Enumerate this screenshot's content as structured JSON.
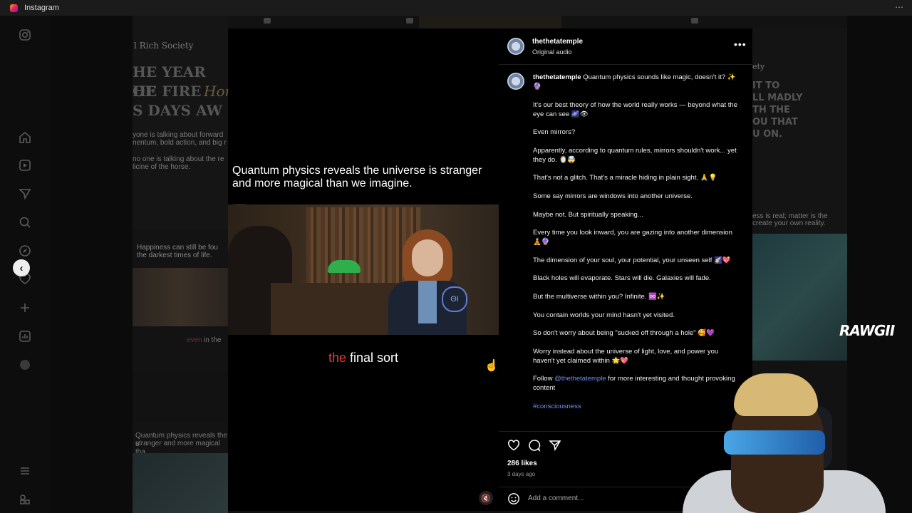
{
  "window": {
    "title": "Instagram",
    "menu_icon": "more-dots-icon"
  },
  "sidebar": {
    "icons": [
      "instagram-logo-icon",
      "home-icon",
      "reels-icon",
      "messages-icon",
      "search-icon",
      "explore-icon",
      "notifications-icon",
      "create-icon",
      "dashboard-icon",
      "profile-icon",
      "menu-icon",
      "also-from-meta-icon"
    ]
  },
  "background_tiles": {
    "left_top": {
      "header": "l Rich Society",
      "big_lines": [
        "HE YEAR OF",
        "HE FIRE",
        "S DAYS AW"
      ],
      "script_word": "Hor",
      "lines": [
        "yone is talking about forward",
        "nentum, bold action, and big r",
        "no one is talking about the re",
        "licine of the horse."
      ]
    },
    "left_mid": {
      "lines": [
        "Happiness can still be fou",
        "the darkest times of life."
      ],
      "caption_tail": "in the",
      "caption_red": "even"
    },
    "left_bottom": {
      "lines": [
        "Quantum physics reveals the u",
        "stranger and more magical tha"
      ]
    },
    "right_top": {
      "small": "ety",
      "big_lines": [
        "IT TO",
        "LL MADLY",
        "TH THE",
        "OU THAT",
        "U ON."
      ],
      "lines": [
        "ess is real; matter is the",
        "create your own reality."
      ]
    }
  },
  "video": {
    "caption_top": "Quantum physics reveals the universe is stranger and more magical than we imagine.",
    "caption_bottom_red": "the",
    "caption_bottom": " final sort",
    "tiny_label": "~~~~~",
    "watermark": "ΘI"
  },
  "post": {
    "username": "thethetatemple",
    "audio": "Original audio",
    "caption_user": "thethetatemple",
    "caption_lines": [
      " Quantum physics sounds like magic, doesn't it? ✨🔮",
      "It's our best theory of how the world really works — beyond what the eye can see 🌌👁",
      "Even mirrors?",
      "Apparently, according to quantum rules, mirrors shouldn't work... yet they do. 🪞🤯",
      "That's not a glitch. That's a miracle hiding in plain sight. 🙏💡",
      "Some say mirrors are windows into another universe.",
      "Maybe not. But spiritually speaking...",
      "Every time you look inward, you are gazing into another dimension 🧘🔮",
      "The dimension of your soul, your potential, your unseen self 🌠💖",
      "Black holes will evaporate. Stars will die. Galaxies will fade.",
      "But the multiverse within you? Infinite. ♾️✨",
      "You contain worlds your mind hasn't yet visited.",
      "So don't worry about being \"sucked off through a hole\" 🥰💜",
      "Worry instead about the universe of light, love, and power you haven't yet claimed within 🌟💖"
    ],
    "follow_prefix": "Follow ",
    "follow_link": "@thethetatemple",
    "follow_suffix": " for more interesting and thought provoking content",
    "hashtag": "#consciousness",
    "likes": "286 likes",
    "time_ago": "3 days ago",
    "comment_placeholder": "Add a comment..."
  },
  "overlay": {
    "brand": "RAWGII"
  },
  "colors": {
    "accent_link": "#6f8ff0",
    "caption_red": "#e23b3b",
    "panel_bg": "#000000"
  }
}
